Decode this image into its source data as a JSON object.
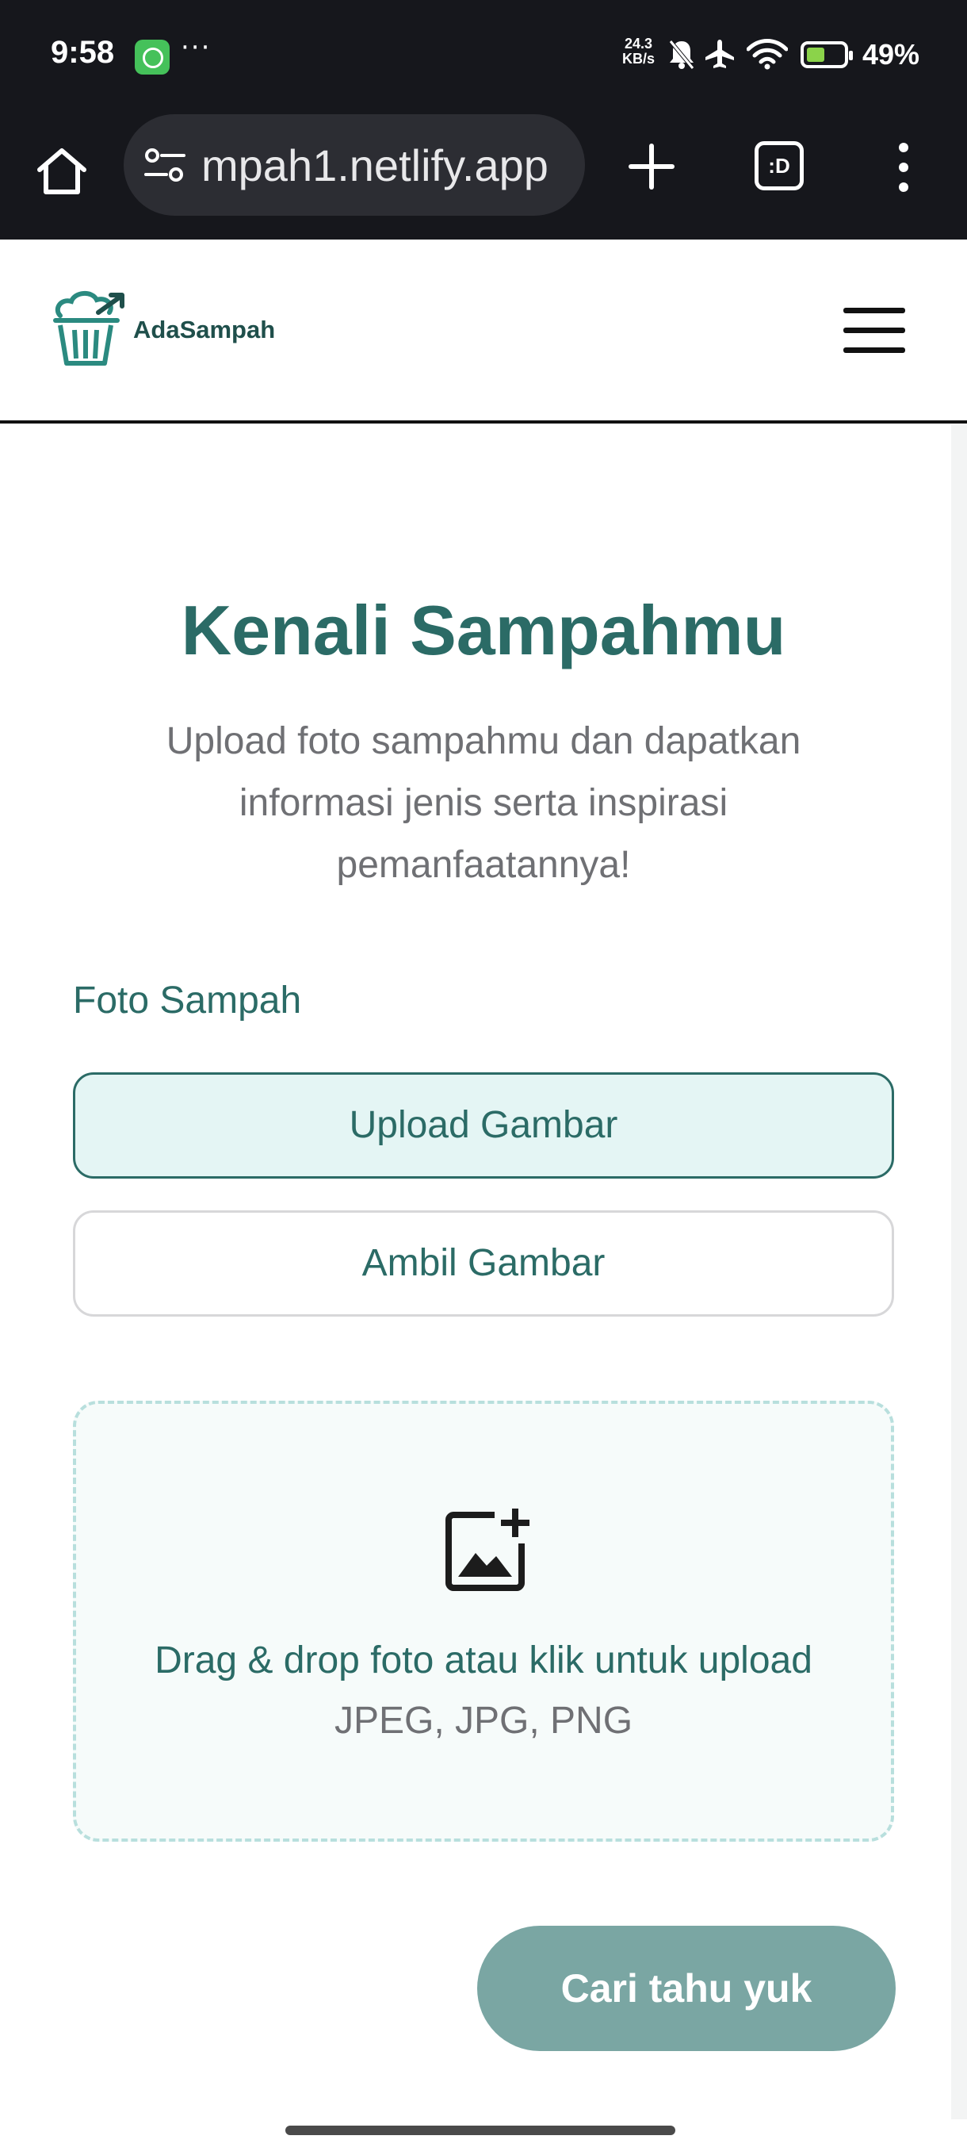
{
  "status_bar": {
    "time": "9:58",
    "notification_icons": [
      "whatsapp-icon"
    ],
    "overflow": "···",
    "net_speed_value": "24.3",
    "net_speed_unit": "KB/s",
    "icons": [
      "mute-icon",
      "airplane-icon",
      "wifi-icon",
      "battery-icon"
    ],
    "battery_level": 0.49,
    "battery_percent": "49%"
  },
  "browser": {
    "url": "mpah1.netlify.app",
    "tabs_label": ":D",
    "icons": [
      "home-icon",
      "site-settings-icon",
      "new-tab-icon",
      "tabs-icon",
      "more-menu-icon"
    ]
  },
  "header": {
    "brand": "AdaSampah",
    "logo_icon": "trash-bin-logo-icon",
    "menu_icon": "hamburger-icon"
  },
  "main": {
    "title": "Kenali Sampahmu",
    "subtitle": "Upload foto sampahmu dan dapatkan informasi jenis serta inspirasi pemanfaatannya!",
    "field_label": "Foto Sampah",
    "upload_button": "Upload Gambar",
    "camera_button": "Ambil Gambar",
    "dropzone_icon": "add-photo-icon",
    "dropzone_text": "Drag & drop foto atau klik untuk upload",
    "dropzone_formats": "JPEG, JPG, PNG",
    "submit_button": "Cari tahu yuk"
  },
  "colors": {
    "accent": "#2b6b66",
    "accent_light": "#e4f5f4",
    "submit_bg": "#7aa6a3",
    "browser_chrome": "#16171c"
  }
}
